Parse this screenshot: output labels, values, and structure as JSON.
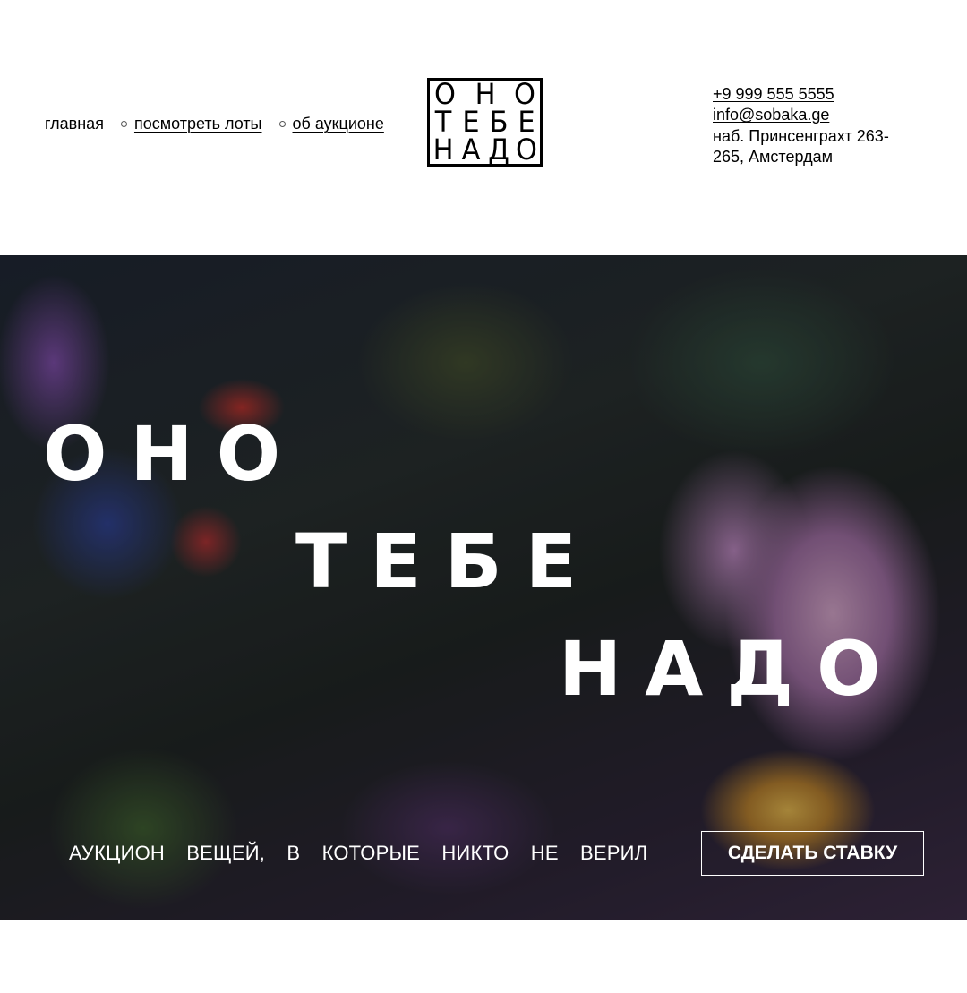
{
  "nav": {
    "home_label": "главная",
    "lots_label": "посмотреть лоты",
    "about_label": "об аукционе"
  },
  "logo": {
    "rows": [
      [
        "О",
        "Н",
        "О"
      ],
      [
        "Т",
        "Е",
        "Б",
        "Е"
      ],
      [
        "Н",
        "А",
        "Д",
        "О"
      ]
    ],
    "text": "ОНО ТЕБЕ НАДО"
  },
  "contacts": {
    "phone": "+9 999 555 5555",
    "email": "info@sobaka.ge",
    "address": "наб. Принсенграхт 263-265, Амстердам"
  },
  "hero": {
    "line1": "ОНО",
    "line2": "ТЕБЕ",
    "line3": "НАДО",
    "tagline": "АУКЦИОН ВЕЩЕЙ, В КОТОРЫЕ НИКТО НЕ ВЕРИЛ",
    "cta_label": "СДЕЛАТЬ СТАВКУ"
  }
}
